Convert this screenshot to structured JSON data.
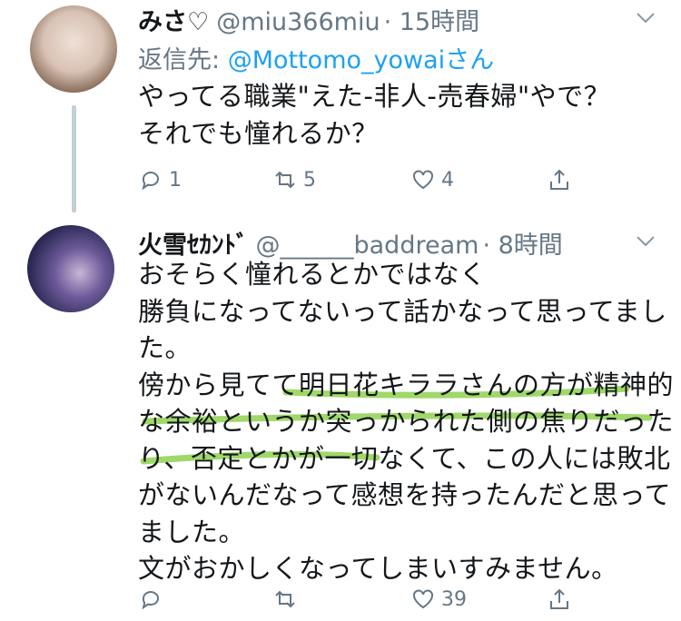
{
  "tweets": [
    {
      "name": "みさ♡",
      "handle": "@miu366miu",
      "time": "· 15時間",
      "reply_prefix": "返信先: ",
      "reply_handle": "@Mottomo_yowai",
      "reply_suffix": "さん",
      "body": "やってる職業\"えた-非人-売春婦\"やで？\nそれでも憧れるか？",
      "reply_count": "1",
      "retweet_count": "5",
      "like_count": "4"
    },
    {
      "name": "火雪ｾｶﾝﾄﾞ",
      "handle": "@______baddream",
      "time": "· 8時間",
      "body": "おそらく憧れるとかではなく\n勝負になってないって話かなって思ってまし\nた。\n傍から見てて明日花キララさんの方が精神的\nな余裕というか突っかられた側の焦りだった\nり、否定とかが一切なくて、この人には敗北\nがないんだなって感想を持ったんだと思って\nました。\n文がおかしくなってしまいすみません。",
      "reply_count": "",
      "retweet_count": "",
      "like_count": "39"
    }
  ],
  "icons": [
    "reply-icon",
    "retweet-icon",
    "like-icon",
    "share-icon",
    "chevron-down-icon"
  ],
  "colors": {
    "highlight": "#8fd14f",
    "link": "#1da1f2",
    "muted": "#657786"
  }
}
